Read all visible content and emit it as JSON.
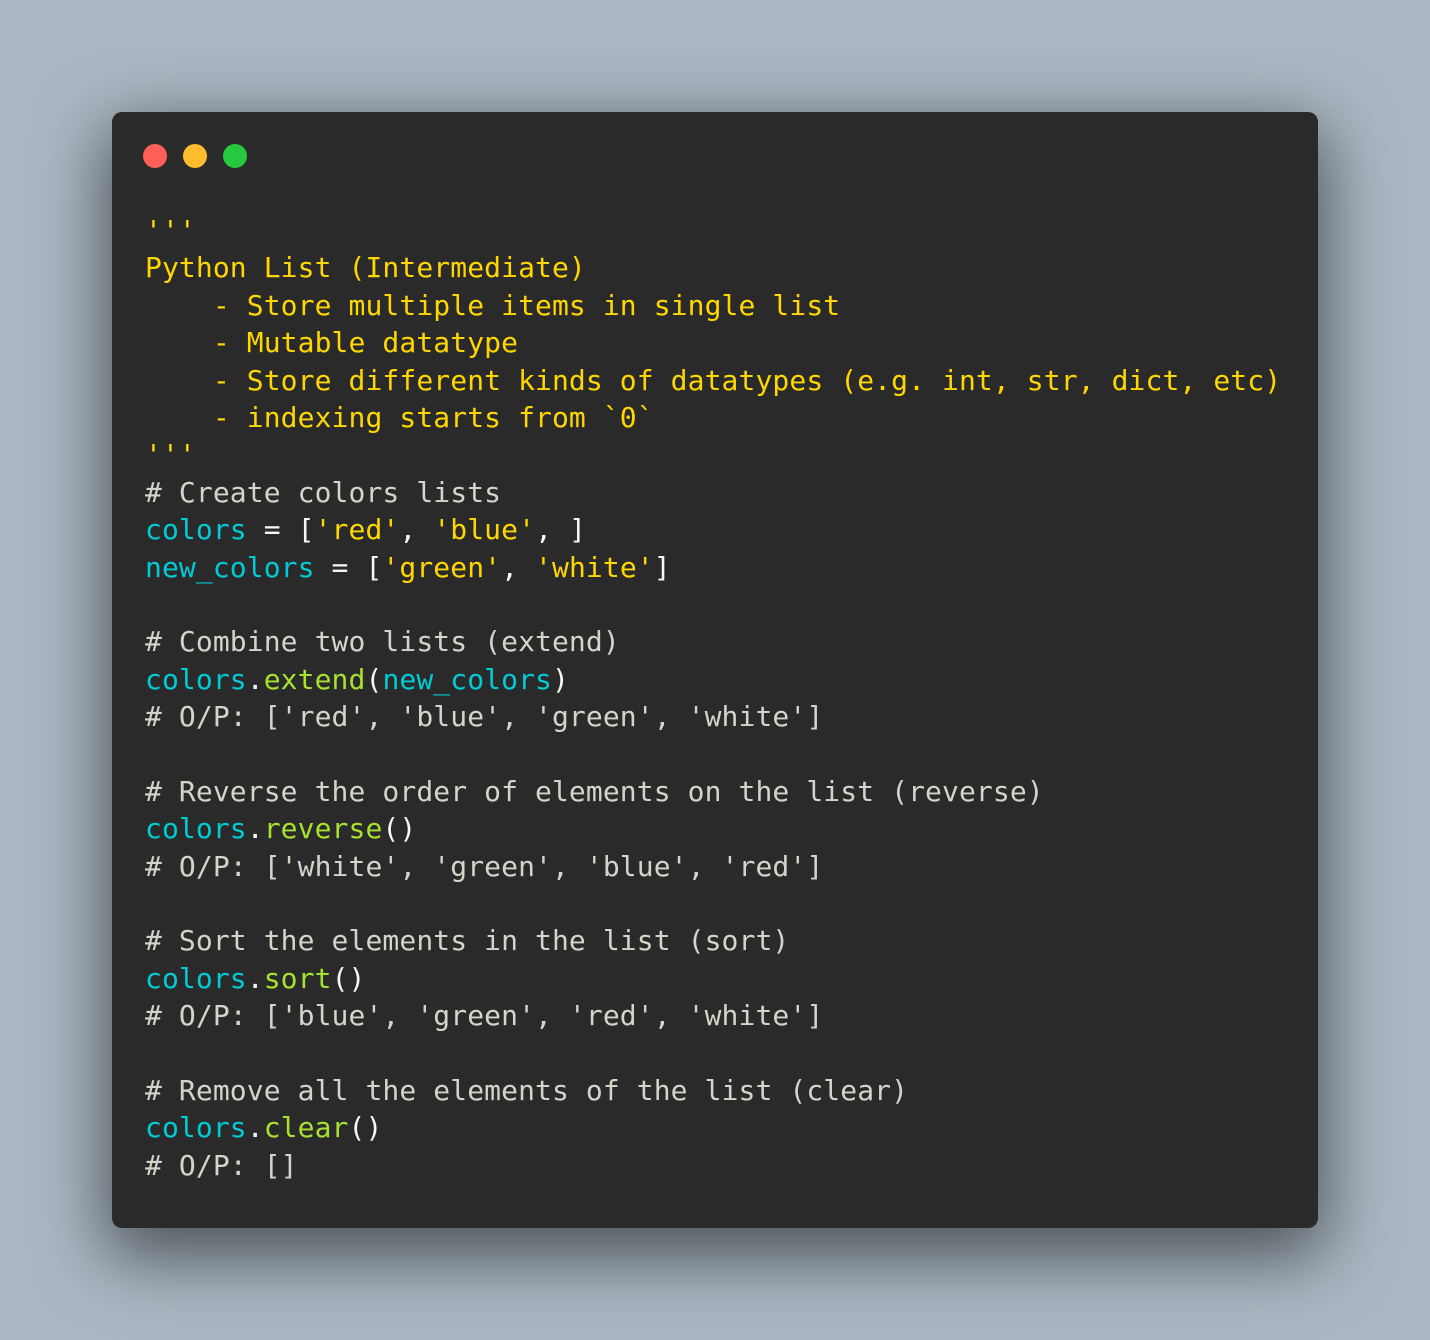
{
  "window": {
    "controls": [
      {
        "name": "close",
        "color": "#ff5f56"
      },
      {
        "name": "minimize",
        "color": "#ffbd2e"
      },
      {
        "name": "maximize",
        "color": "#27c93f"
      }
    ]
  },
  "colors": {
    "background": "#abb8c3",
    "editor": "#2a2a2a",
    "docstring": "#ffd700",
    "comment": "#d4d4c8",
    "variable": "#00ccd6",
    "method": "#a6e22e",
    "string": "#ffd700",
    "text": "#f8f8f2"
  },
  "code": {
    "lines": [
      [
        {
          "t": "'''",
          "k": "doc"
        }
      ],
      [
        {
          "t": "Python List (Intermediate)",
          "k": "doc"
        }
      ],
      [
        {
          "t": "    - Store multiple items in single list",
          "k": "doc"
        }
      ],
      [
        {
          "t": "    - Mutable datatype",
          "k": "doc"
        }
      ],
      [
        {
          "t": "    - Store different kinds of datatypes (e.g. int, str, dict, etc)",
          "k": "doc"
        }
      ],
      [
        {
          "t": "    - indexing starts from `0`",
          "k": "doc"
        }
      ],
      [
        {
          "t": "'''",
          "k": "doc"
        }
      ],
      [
        {
          "t": "# Create colors lists",
          "k": "comment"
        }
      ],
      [
        {
          "t": "colors",
          "k": "var"
        },
        {
          "t": " = [",
          "k": "text"
        },
        {
          "t": "'red'",
          "k": "str"
        },
        {
          "t": ", ",
          "k": "text"
        },
        {
          "t": "'blue'",
          "k": "str"
        },
        {
          "t": ", ]",
          "k": "text"
        }
      ],
      [
        {
          "t": "new_colors",
          "k": "var"
        },
        {
          "t": " = [",
          "k": "text"
        },
        {
          "t": "'green'",
          "k": "str"
        },
        {
          "t": ", ",
          "k": "text"
        },
        {
          "t": "'white'",
          "k": "str"
        },
        {
          "t": "]",
          "k": "text"
        }
      ],
      [],
      [
        {
          "t": "# Combine two lists (extend)",
          "k": "comment"
        }
      ],
      [
        {
          "t": "colors",
          "k": "var"
        },
        {
          "t": ".",
          "k": "text"
        },
        {
          "t": "extend",
          "k": "method"
        },
        {
          "t": "(",
          "k": "text"
        },
        {
          "t": "new_colors",
          "k": "var"
        },
        {
          "t": ")",
          "k": "text"
        }
      ],
      [
        {
          "t": "# O/P: ['red', 'blue', 'green', 'white']",
          "k": "comment"
        }
      ],
      [],
      [
        {
          "t": "# Reverse the order of elements on the list (reverse)",
          "k": "comment"
        }
      ],
      [
        {
          "t": "colors",
          "k": "var"
        },
        {
          "t": ".",
          "k": "text"
        },
        {
          "t": "reverse",
          "k": "method"
        },
        {
          "t": "()",
          "k": "text"
        }
      ],
      [
        {
          "t": "# O/P: ['white', 'green', 'blue', 'red']",
          "k": "comment"
        }
      ],
      [],
      [
        {
          "t": "# Sort the elements in the list (sort)",
          "k": "comment"
        }
      ],
      [
        {
          "t": "colors",
          "k": "var"
        },
        {
          "t": ".",
          "k": "text"
        },
        {
          "t": "sort",
          "k": "method"
        },
        {
          "t": "()",
          "k": "text"
        }
      ],
      [
        {
          "t": "# O/P: ['blue', 'green', 'red', 'white']",
          "k": "comment"
        }
      ],
      [],
      [
        {
          "t": "# Remove all the elements of the list (clear)",
          "k": "comment"
        }
      ],
      [
        {
          "t": "colors",
          "k": "var"
        },
        {
          "t": ".",
          "k": "text"
        },
        {
          "t": "clear",
          "k": "method"
        },
        {
          "t": "()",
          "k": "text"
        }
      ],
      [
        {
          "t": "# O/P: []",
          "k": "comment"
        }
      ]
    ]
  }
}
